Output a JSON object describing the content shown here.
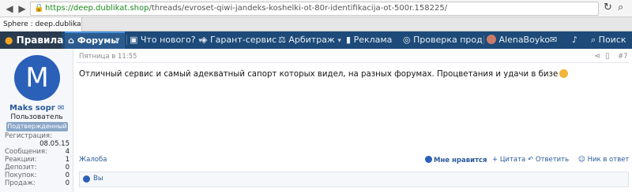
{
  "browser": {
    "url_host": "https://deep.dublikat.shop",
    "url_path": "/threads/evroset-qiwi-jandeks-koshelki-ot-80r-identifikacija-ot-500r.158225/",
    "tab_title": "Sphere : deep.dublikat.shop"
  },
  "nav": {
    "logo": "Правила",
    "forums": "Форумы",
    "whats_new": "Что нового?",
    "guarantee": "Гарант-сервис",
    "arbitrage": "Арбитраж",
    "ads": "Реклама",
    "check": "Проверка прод",
    "username": "AlenaBoyko",
    "search": "Поиск"
  },
  "user": {
    "avatar_letter": "M",
    "name": "Maks sopr",
    "title": "Пользователь",
    "badge": "Подтвержденный",
    "stats": [
      {
        "label": "Регистрация:",
        "value": ""
      },
      {
        "label": "",
        "value": "08.05.15"
      },
      {
        "label": "Сообщения:",
        "value": "4"
      },
      {
        "label": "Реакции:",
        "value": "1"
      },
      {
        "label": "Депозит:",
        "value": "0"
      },
      {
        "label": "Покупок:",
        "value": "0"
      },
      {
        "label": "Продаж:",
        "value": "0"
      }
    ]
  },
  "post": {
    "date": "Пятница в 11:55",
    "number": "#7",
    "text": "Отличный сервис и самый адекватный сапорт которых видел, на разных форумах. Процветания и удачи в бизе"
  },
  "actions": {
    "report": "Жалоба",
    "like": "Мне нравится",
    "quote": "+ Цитата",
    "reply": "Ответить",
    "mention": "Ник в ответ"
  },
  "likes": {
    "text": "Вы"
  }
}
